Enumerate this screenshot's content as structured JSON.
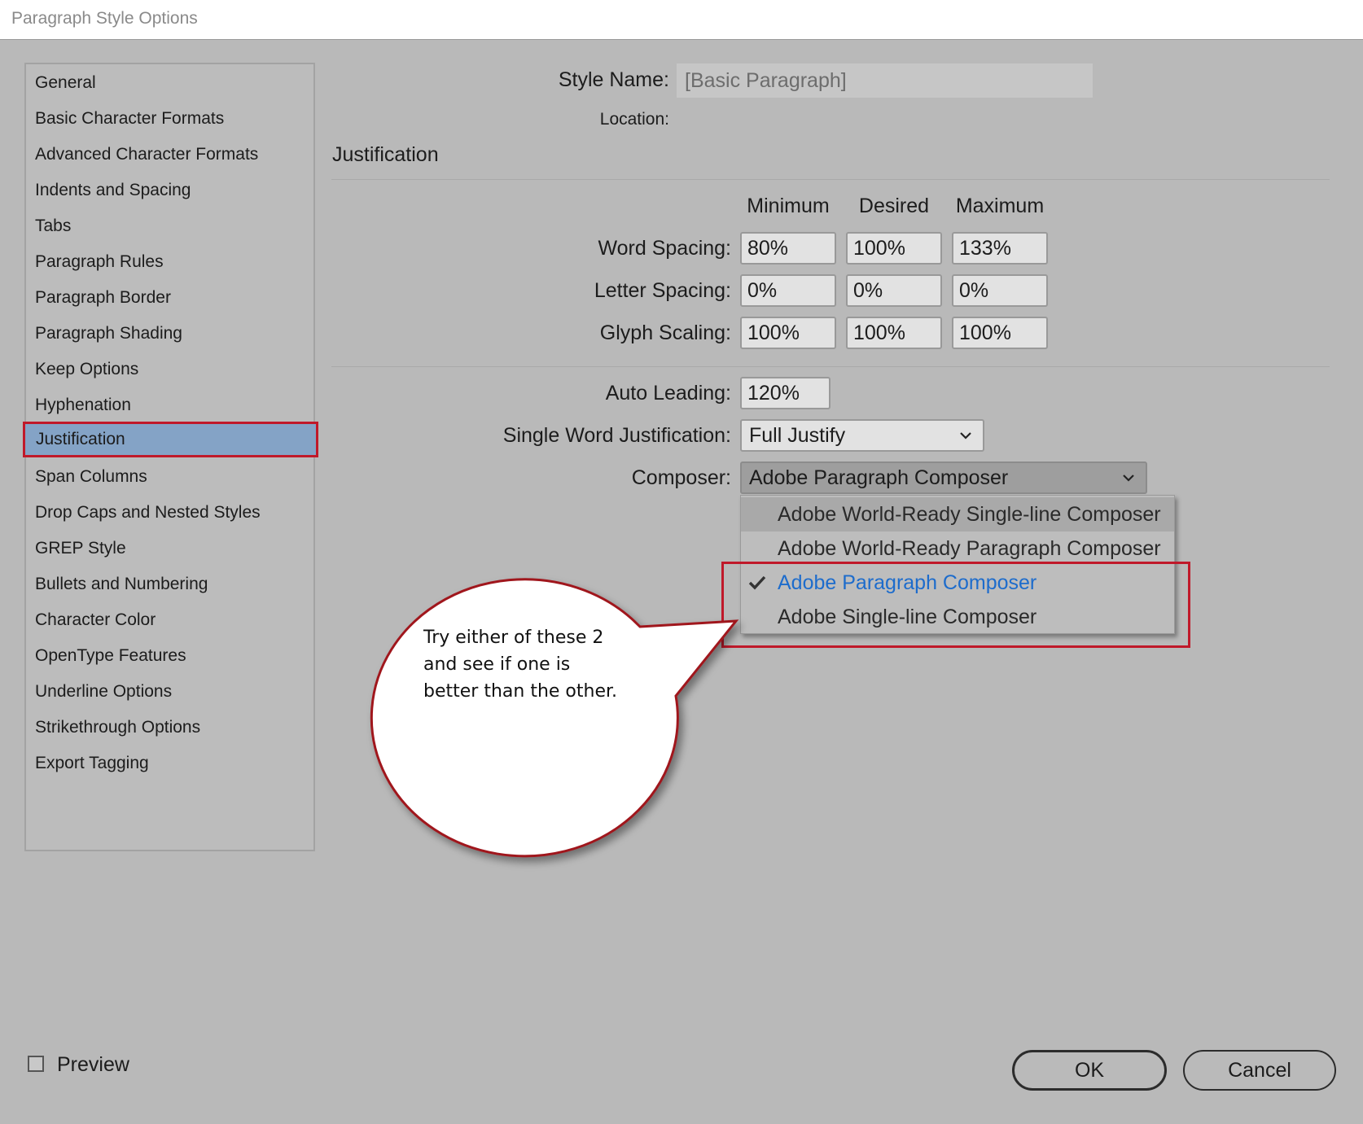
{
  "window": {
    "title": "Paragraph Style Options"
  },
  "sidebar": {
    "items": [
      {
        "label": "General"
      },
      {
        "label": "Basic Character Formats"
      },
      {
        "label": "Advanced Character Formats"
      },
      {
        "label": "Indents and Spacing"
      },
      {
        "label": "Tabs"
      },
      {
        "label": "Paragraph Rules"
      },
      {
        "label": "Paragraph Border"
      },
      {
        "label": "Paragraph Shading"
      },
      {
        "label": "Keep Options"
      },
      {
        "label": "Hyphenation"
      },
      {
        "label": "Justification",
        "selected": true
      },
      {
        "label": "Span Columns"
      },
      {
        "label": "Drop Caps and Nested Styles"
      },
      {
        "label": "GREP Style"
      },
      {
        "label": "Bullets and Numbering"
      },
      {
        "label": "Character Color"
      },
      {
        "label": "OpenType Features"
      },
      {
        "label": "Underline Options"
      },
      {
        "label": "Strikethrough Options"
      },
      {
        "label": "Export Tagging"
      }
    ]
  },
  "header": {
    "style_name_label": "Style Name:",
    "style_name_value": "[Basic Paragraph]",
    "location_label": "Location:"
  },
  "section": {
    "title": "Justification"
  },
  "spacing_table": {
    "columns": [
      "Minimum",
      "Desired",
      "Maximum"
    ],
    "rows": [
      {
        "label": "Word Spacing:",
        "values": [
          "80%",
          "100%",
          "133%"
        ]
      },
      {
        "label": "Letter Spacing:",
        "values": [
          "0%",
          "0%",
          "0%"
        ]
      },
      {
        "label": "Glyph Scaling:",
        "values": [
          "100%",
          "100%",
          "100%"
        ]
      }
    ]
  },
  "auto_leading": {
    "label": "Auto Leading:",
    "value": "120%"
  },
  "single_word": {
    "label": "Single Word Justification:",
    "value": "Full Justify"
  },
  "composer": {
    "label": "Composer:",
    "value": "Adobe Paragraph Composer",
    "options": [
      {
        "label": "Adobe World-Ready Single-line Composer",
        "hover": true
      },
      {
        "label": "Adobe World-Ready Paragraph Composer"
      },
      {
        "label": "Adobe Paragraph Composer",
        "checked": true
      },
      {
        "label": "Adobe Single-line Composer"
      }
    ]
  },
  "callout": {
    "lines": [
      "Try either of these 2",
      "and see if one is",
      "better than the other."
    ]
  },
  "footer": {
    "preview_label": "Preview",
    "ok_label": "OK",
    "cancel_label": "Cancel"
  },
  "colors": {
    "background": "#b9b9b9",
    "selection": "#84a3c6",
    "highlight_border": "#c0192a",
    "checked_text": "#1d6ccc"
  }
}
